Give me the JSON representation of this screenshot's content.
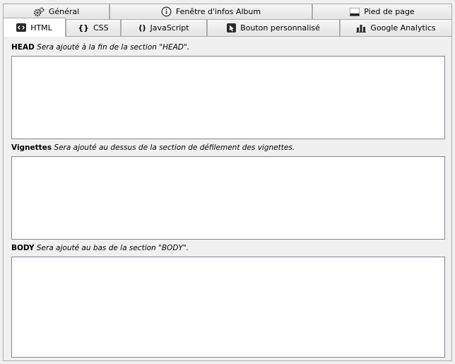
{
  "tabs_row1": [
    {
      "label": "Général",
      "icon": "gears-icon"
    },
    {
      "label": "Fenêtre d'infos Album",
      "icon": "info-icon"
    },
    {
      "label": "Pied de page",
      "icon": "footer-icon"
    }
  ],
  "tabs_row2": [
    {
      "label": "HTML",
      "icon": "code-icon",
      "active": true
    },
    {
      "label": "CSS",
      "icon": "braces-icon"
    },
    {
      "label": "JavaScript",
      "icon": "parens-icon"
    },
    {
      "label": "Bouton personnalisé",
      "icon": "cursor-icon"
    },
    {
      "label": "Google Analytics",
      "icon": "bar-chart-icon"
    }
  ],
  "sections": {
    "head": {
      "title": "HEAD",
      "hint": "Sera ajouté à la fin de la section \"HEAD\".",
      "value": ""
    },
    "thumbs": {
      "title": "Vignettes",
      "hint": "Sera ajouté au dessus de la section de défilement des vignettes.",
      "value": ""
    },
    "body": {
      "title": "BODY",
      "hint": "Sera ajouté au bas de la section \"BODY\".",
      "value": ""
    }
  }
}
